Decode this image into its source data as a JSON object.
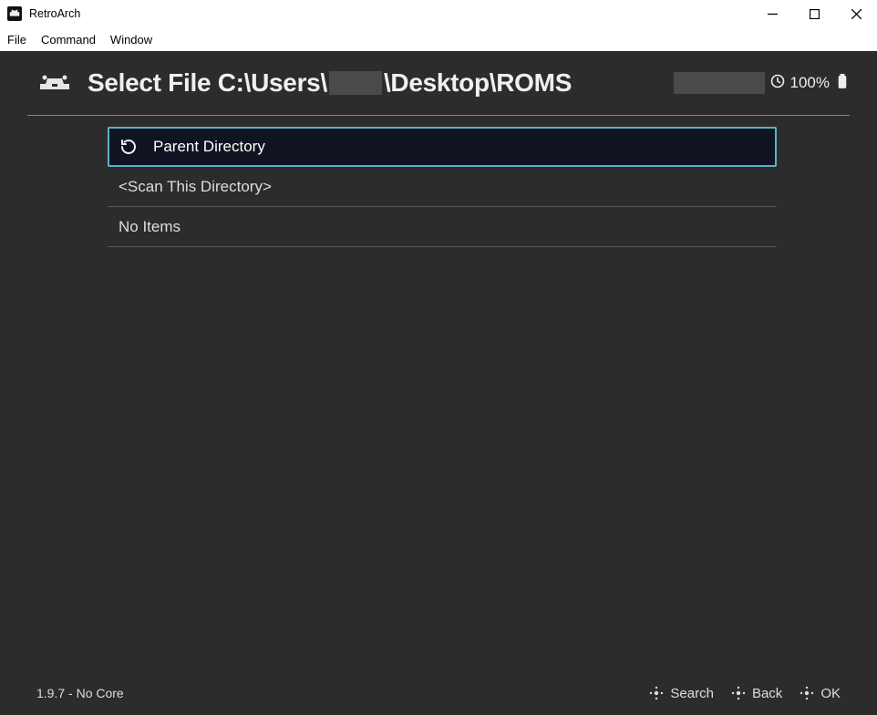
{
  "window": {
    "title": "RetroArch"
  },
  "menubar": {
    "items": [
      {
        "label": "File"
      },
      {
        "label": "Command"
      },
      {
        "label": "Window"
      }
    ]
  },
  "header": {
    "title_prefix": "Select File C:\\Users\\",
    "title_suffix": "\\Desktop\\ROMS",
    "battery_percent": "100%"
  },
  "list": {
    "items": [
      {
        "label": "Parent Directory",
        "selected": true,
        "has_icon": true
      },
      {
        "label": "<Scan This Directory>",
        "selected": false,
        "has_icon": false
      },
      {
        "label": "No Items",
        "selected": false,
        "has_icon": false
      }
    ]
  },
  "footer": {
    "version": "1.9.7 - No Core",
    "hints": [
      {
        "label": "Search"
      },
      {
        "label": "Back"
      },
      {
        "label": "OK"
      }
    ]
  }
}
